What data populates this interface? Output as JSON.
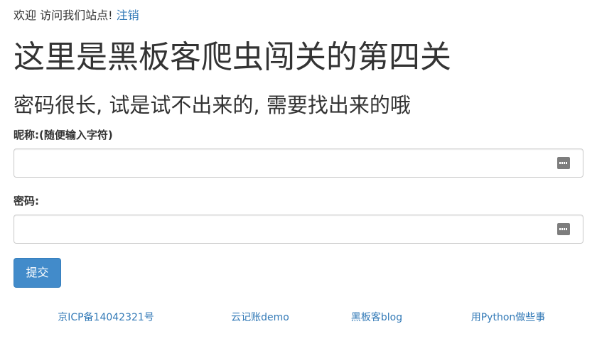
{
  "header": {
    "welcome_text": "欢迎 访问我们站点! ",
    "logout_link": "注销"
  },
  "main": {
    "title": "这里是黑板客爬虫闯关的第四关",
    "subtitle": "密码很长, 试是试不出来的, 需要找出来的哦"
  },
  "form": {
    "nickname_label": "昵称:(随便输入字符)",
    "nickname_value": "",
    "nickname_icon": "password-manager-icon",
    "password_label": "密码:",
    "password_value": "",
    "password_icon": "password-manager-icon",
    "submit_label": "提交"
  },
  "footer": {
    "links": [
      "京ICP备14042321号",
      "云记账demo",
      "黑板客blog",
      "用Python做些事"
    ]
  },
  "colors": {
    "link": "#337ab7",
    "button_bg": "#428bca",
    "text": "#333333"
  }
}
